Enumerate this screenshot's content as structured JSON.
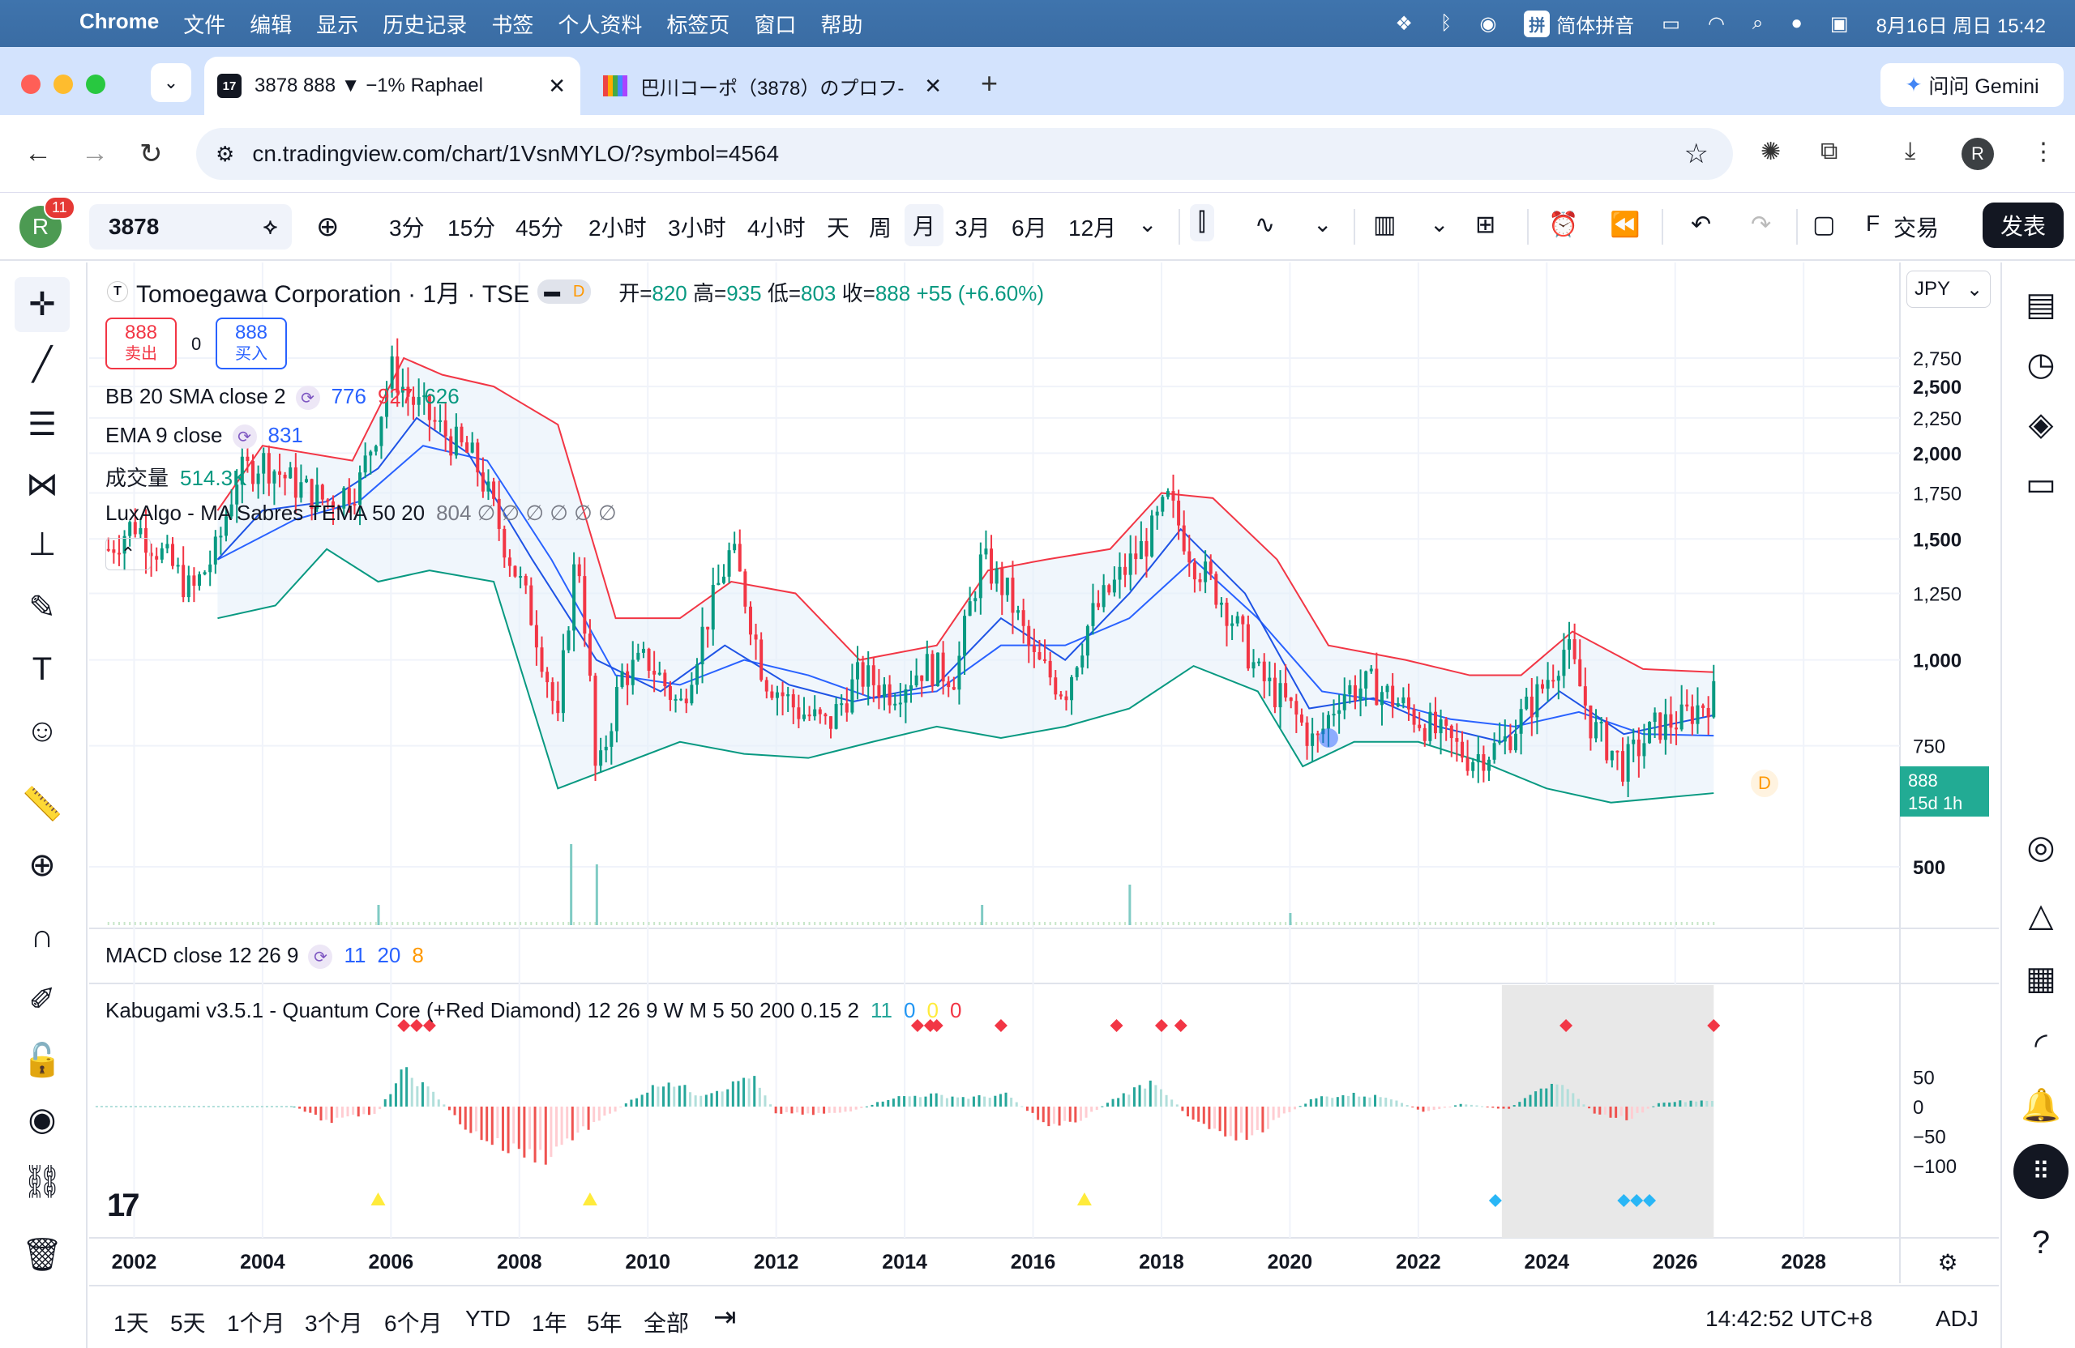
{
  "macos": {
    "app": "Chrome",
    "menus": [
      "文件",
      "编辑",
      "显示",
      "历史记录",
      "书签",
      "个人资料",
      "标签页",
      "窗口",
      "帮助"
    ],
    "ime": "拼",
    "ime_label": "简体拼音",
    "datetime": "8月16日 周日 15:42"
  },
  "chrome": {
    "tabs": [
      {
        "title": "3878 888 ▼ −1% Raphael",
        "favicon": "17"
      },
      {
        "title": "巴川コーポ（3878）のプロフ‐"
      }
    ],
    "gemini": "问问 Gemini",
    "url": "cn.tradingview.com/chart/1VsnMYLO/?symbol=4564",
    "avatar": "R"
  },
  "toolbar": {
    "avatar": "R",
    "notifications": "11",
    "symbol": "3878",
    "intervals": [
      "3分",
      "15分",
      "45分",
      "2小时",
      "3小时",
      "4小时",
      "天",
      "周",
      "月",
      "3月",
      "6月",
      "12月"
    ],
    "selected_interval": "月",
    "truncated": "F",
    "trade": "交易",
    "publish": "发表"
  },
  "chart": {
    "title": "Tomoegawa Corporation · 1月 · TSE",
    "t_badge": "T",
    "d_badge": "D",
    "ohlc": {
      "open_label": "开=",
      "open": "820",
      "high_label": "高=",
      "high": "935",
      "low_label": "低=",
      "low": "803",
      "close_label": "收=",
      "close": "888",
      "change": "+55 (+6.60%)"
    },
    "sell": {
      "price": "888",
      "label": "卖出"
    },
    "buy": {
      "price": "888",
      "label": "买入"
    },
    "spread": "0",
    "currency": "JPY",
    "price_label": {
      "price": "888",
      "countdown": "15d 1h"
    },
    "d_marker": "D",
    "indicators": [
      {
        "name": "BB 20 SMA close 2",
        "values": [
          "776",
          "927",
          "626"
        ],
        "colors": [
          "#2962ff",
          "#f23645",
          "#089981"
        ]
      },
      {
        "name": "EMA 9 close",
        "values": [
          "831"
        ],
        "colors": [
          "#2962ff"
        ]
      },
      {
        "name": "成交量",
        "values": [
          "514.3K"
        ],
        "colors": [
          "#089981"
        ]
      },
      {
        "name": "LuxAlgo - MA Sabres TEMA 50 20",
        "values": [
          "804 ∅ ∅ ∅ ∅ ∅ ∅"
        ],
        "colors": [
          "#787b86"
        ]
      }
    ],
    "macd": {
      "name": "MACD close 12 26 9",
      "values": [
        "11",
        "20",
        "8"
      ],
      "colors": [
        "#2962ff",
        "#2962ff",
        "#ff9800"
      ]
    },
    "kabugami": {
      "name": "Kabugami v3.5.1 - Quantum Core (+Red Diamond) 12 26 9 W M 5 50 200 0.15 2",
      "values": [
        "11",
        "0",
        "0",
        "0"
      ],
      "colors": [
        "#26a69a",
        "#2196f3",
        "#ffeb3b",
        "#f23645"
      ]
    },
    "price_axis": [
      "2,750",
      "2,500",
      "2,250",
      "2,000",
      "1,750",
      "1,500",
      "1,250",
      "1,000",
      "750",
      "500"
    ],
    "osc_axis": [
      "50",
      "0",
      "−50",
      "−100"
    ],
    "time_axis": [
      "2002",
      "2004",
      "2006",
      "2008",
      "2010",
      "2012",
      "2014",
      "2016",
      "2018",
      "2020",
      "2022",
      "2024",
      "2026",
      "2028"
    ]
  },
  "chart_data": {
    "type": "candlestick",
    "interval": "monthly",
    "symbol": "3878 TSE",
    "currency": "JPY",
    "ylim": [
      400,
      2900
    ],
    "x_range": [
      2001.3,
      2029.5
    ],
    "close_series": [
      {
        "x": 2001.6,
        "y": 1450
      },
      {
        "x": 2002.0,
        "y": 1580
      },
      {
        "x": 2002.5,
        "y": 1400
      },
      {
        "x": 2002.9,
        "y": 1250
      },
      {
        "x": 2003.3,
        "y": 1450
      },
      {
        "x": 2003.6,
        "y": 1850
      },
      {
        "x": 2004.0,
        "y": 1950
      },
      {
        "x": 2004.5,
        "y": 1800
      },
      {
        "x": 2005.0,
        "y": 1700
      },
      {
        "x": 2005.5,
        "y": 1800
      },
      {
        "x": 2005.8,
        "y": 2200
      },
      {
        "x": 2006.0,
        "y": 2650
      },
      {
        "x": 2006.3,
        "y": 2400
      },
      {
        "x": 2006.8,
        "y": 2150
      },
      {
        "x": 2007.3,
        "y": 1950
      },
      {
        "x": 2007.8,
        "y": 1450
      },
      {
        "x": 2008.2,
        "y": 1150
      },
      {
        "x": 2008.6,
        "y": 800
      },
      {
        "x": 2008.9,
        "y": 1450
      },
      {
        "x": 2009.2,
        "y": 650
      },
      {
        "x": 2009.6,
        "y": 950
      },
      {
        "x": 2010.0,
        "y": 1000
      },
      {
        "x": 2010.5,
        "y": 850
      },
      {
        "x": 2011.0,
        "y": 1200
      },
      {
        "x": 2011.3,
        "y": 1450
      },
      {
        "x": 2011.8,
        "y": 950
      },
      {
        "x": 2012.3,
        "y": 850
      },
      {
        "x": 2012.8,
        "y": 800
      },
      {
        "x": 2013.3,
        "y": 950
      },
      {
        "x": 2013.8,
        "y": 900
      },
      {
        "x": 2014.3,
        "y": 980
      },
      {
        "x": 2014.8,
        "y": 950
      },
      {
        "x": 2015.2,
        "y": 1400
      },
      {
        "x": 2015.6,
        "y": 1250
      },
      {
        "x": 2016.0,
        "y": 1000
      },
      {
        "x": 2016.5,
        "y": 900
      },
      {
        "x": 2016.9,
        "y": 1150
      },
      {
        "x": 2017.3,
        "y": 1300
      },
      {
        "x": 2017.8,
        "y": 1500
      },
      {
        "x": 2018.1,
        "y": 1700
      },
      {
        "x": 2018.5,
        "y": 1400
      },
      {
        "x": 2019.0,
        "y": 1200
      },
      {
        "x": 2019.5,
        "y": 950
      },
      {
        "x": 2020.0,
        "y": 850
      },
      {
        "x": 2020.4,
        "y": 750
      },
      {
        "x": 2020.8,
        "y": 900
      },
      {
        "x": 2021.3,
        "y": 920
      },
      {
        "x": 2021.8,
        "y": 850
      },
      {
        "x": 2022.3,
        "y": 780
      },
      {
        "x": 2022.8,
        "y": 720
      },
      {
        "x": 2023.3,
        "y": 750
      },
      {
        "x": 2023.9,
        "y": 900
      },
      {
        "x": 2024.3,
        "y": 1050
      },
      {
        "x": 2024.7,
        "y": 800
      },
      {
        "x": 2025.2,
        "y": 700
      },
      {
        "x": 2025.7,
        "y": 800
      },
      {
        "x": 2026.1,
        "y": 820
      },
      {
        "x": 2026.6,
        "y": 888
      }
    ],
    "bb_upper": [
      {
        "x": 2003.3,
        "y": 1650
      },
      {
        "x": 2004.0,
        "y": 2050
      },
      {
        "x": 2004.7,
        "y": 2000
      },
      {
        "x": 2005.4,
        "y": 1950
      },
      {
        "x": 2006.2,
        "y": 2750
      },
      {
        "x": 2006.8,
        "y": 2600
      },
      {
        "x": 2007.6,
        "y": 2500
      },
      {
        "x": 2008.6,
        "y": 2200
      },
      {
        "x": 2009.5,
        "y": 1150
      },
      {
        "x": 2010.5,
        "y": 1150
      },
      {
        "x": 2011.3,
        "y": 1300
      },
      {
        "x": 2012.3,
        "y": 1250
      },
      {
        "x": 2013.3,
        "y": 1000
      },
      {
        "x": 2014.5,
        "y": 1050
      },
      {
        "x": 2015.3,
        "y": 1350
      },
      {
        "x": 2016.2,
        "y": 1400
      },
      {
        "x": 2017.2,
        "y": 1450
      },
      {
        "x": 2018.0,
        "y": 1750
      },
      {
        "x": 2018.8,
        "y": 1720
      },
      {
        "x": 2019.8,
        "y": 1400
      },
      {
        "x": 2020.6,
        "y": 1050
      },
      {
        "x": 2021.8,
        "y": 1000
      },
      {
        "x": 2022.8,
        "y": 950
      },
      {
        "x": 2023.6,
        "y": 950
      },
      {
        "x": 2024.4,
        "y": 1100
      },
      {
        "x": 2025.5,
        "y": 970
      },
      {
        "x": 2026.6,
        "y": 960
      }
    ],
    "bb_lower": [
      {
        "x": 2003.3,
        "y": 1150
      },
      {
        "x": 2004.2,
        "y": 1200
      },
      {
        "x": 2005.0,
        "y": 1450
      },
      {
        "x": 2005.8,
        "y": 1300
      },
      {
        "x": 2006.6,
        "y": 1350
      },
      {
        "x": 2007.6,
        "y": 1300
      },
      {
        "x": 2008.6,
        "y": 650
      },
      {
        "x": 2009.5,
        "y": 700
      },
      {
        "x": 2010.5,
        "y": 760
      },
      {
        "x": 2011.5,
        "y": 730
      },
      {
        "x": 2012.5,
        "y": 720
      },
      {
        "x": 2013.5,
        "y": 760
      },
      {
        "x": 2014.5,
        "y": 800
      },
      {
        "x": 2015.5,
        "y": 770
      },
      {
        "x": 2016.5,
        "y": 800
      },
      {
        "x": 2017.5,
        "y": 850
      },
      {
        "x": 2018.5,
        "y": 980
      },
      {
        "x": 2019.5,
        "y": 900
      },
      {
        "x": 2020.2,
        "y": 700
      },
      {
        "x": 2021.0,
        "y": 760
      },
      {
        "x": 2022.0,
        "y": 760
      },
      {
        "x": 2023.0,
        "y": 710
      },
      {
        "x": 2024.0,
        "y": 650
      },
      {
        "x": 2025.0,
        "y": 620
      },
      {
        "x": 2026.6,
        "y": 640
      }
    ],
    "ema9": [
      {
        "x": 2003.3,
        "y": 1400
      },
      {
        "x": 2004.0,
        "y": 1650
      },
      {
        "x": 2005.0,
        "y": 1700
      },
      {
        "x": 2005.8,
        "y": 1900
      },
      {
        "x": 2006.4,
        "y": 2250
      },
      {
        "x": 2007.2,
        "y": 2000
      },
      {
        "x": 2008.2,
        "y": 1400
      },
      {
        "x": 2009.2,
        "y": 1000
      },
      {
        "x": 2010.2,
        "y": 900
      },
      {
        "x": 2011.2,
        "y": 1050
      },
      {
        "x": 2012.2,
        "y": 920
      },
      {
        "x": 2013.2,
        "y": 870
      },
      {
        "x": 2014.5,
        "y": 920
      },
      {
        "x": 2015.5,
        "y": 1150
      },
      {
        "x": 2016.5,
        "y": 1000
      },
      {
        "x": 2017.5,
        "y": 1250
      },
      {
        "x": 2018.3,
        "y": 1550
      },
      {
        "x": 2019.3,
        "y": 1250
      },
      {
        "x": 2020.3,
        "y": 850
      },
      {
        "x": 2021.3,
        "y": 880
      },
      {
        "x": 2022.3,
        "y": 800
      },
      {
        "x": 2023.3,
        "y": 760
      },
      {
        "x": 2024.2,
        "y": 900
      },
      {
        "x": 2025.2,
        "y": 780
      },
      {
        "x": 2026.6,
        "y": 831
      }
    ],
    "bb_basis": [
      {
        "x": 2003.3,
        "y": 1400
      },
      {
        "x": 2004.5,
        "y": 1600
      },
      {
        "x": 2005.5,
        "y": 1700
      },
      {
        "x": 2006.5,
        "y": 2050
      },
      {
        "x": 2007.5,
        "y": 1950
      },
      {
        "x": 2008.5,
        "y": 1400
      },
      {
        "x": 2009.5,
        "y": 950
      },
      {
        "x": 2010.5,
        "y": 920
      },
      {
        "x": 2011.5,
        "y": 1000
      },
      {
        "x": 2012.5,
        "y": 950
      },
      {
        "x": 2013.5,
        "y": 880
      },
      {
        "x": 2014.5,
        "y": 900
      },
      {
        "x": 2015.5,
        "y": 1050
      },
      {
        "x": 2016.5,
        "y": 1050
      },
      {
        "x": 2017.5,
        "y": 1150
      },
      {
        "x": 2018.5,
        "y": 1400
      },
      {
        "x": 2019.5,
        "y": 1150
      },
      {
        "x": 2020.5,
        "y": 900
      },
      {
        "x": 2021.5,
        "y": 870
      },
      {
        "x": 2022.5,
        "y": 820
      },
      {
        "x": 2023.5,
        "y": 800
      },
      {
        "x": 2024.5,
        "y": 840
      },
      {
        "x": 2025.5,
        "y": 780
      },
      {
        "x": 2026.6,
        "y": 776
      }
    ],
    "oscillator": [
      {
        "x": 2001.3,
        "y": 0
      },
      {
        "x": 2004.5,
        "y": 0
      },
      {
        "x": 2005.0,
        "y": -25
      },
      {
        "x": 2005.8,
        "y": -10
      },
      {
        "x": 2006.2,
        "y": 60
      },
      {
        "x": 2006.7,
        "y": 20
      },
      {
        "x": 2007.2,
        "y": -40
      },
      {
        "x": 2007.8,
        "y": -70
      },
      {
        "x": 2008.4,
        "y": -85
      },
      {
        "x": 2008.9,
        "y": -45
      },
      {
        "x": 2009.4,
        "y": -15
      },
      {
        "x": 2009.8,
        "y": 15
      },
      {
        "x": 2010.3,
        "y": 45
      },
      {
        "x": 2010.8,
        "y": 20
      },
      {
        "x": 2011.3,
        "y": 35
      },
      {
        "x": 2011.6,
        "y": 55
      },
      {
        "x": 2012.0,
        "y": -10
      },
      {
        "x": 2012.6,
        "y": -12
      },
      {
        "x": 2013.2,
        "y": -8
      },
      {
        "x": 2013.8,
        "y": 15
      },
      {
        "x": 2014.4,
        "y": 20
      },
      {
        "x": 2015.0,
        "y": 15
      },
      {
        "x": 2015.6,
        "y": 20
      },
      {
        "x": 2016.2,
        "y": -30
      },
      {
        "x": 2016.7,
        "y": -25
      },
      {
        "x": 2017.3,
        "y": 15
      },
      {
        "x": 2017.9,
        "y": 45
      },
      {
        "x": 2018.4,
        "y": -15
      },
      {
        "x": 2018.9,
        "y": -40
      },
      {
        "x": 2019.4,
        "y": -55
      },
      {
        "x": 2019.9,
        "y": -15
      },
      {
        "x": 2020.4,
        "y": 15
      },
      {
        "x": 2021.0,
        "y": 20
      },
      {
        "x": 2021.6,
        "y": 15
      },
      {
        "x": 2022.1,
        "y": -10
      },
      {
        "x": 2022.7,
        "y": 5
      },
      {
        "x": 2023.4,
        "y": -5
      },
      {
        "x": 2023.9,
        "y": 35
      },
      {
        "x": 2024.3,
        "y": 30
      },
      {
        "x": 2024.8,
        "y": -15
      },
      {
        "x": 2025.3,
        "y": -20
      },
      {
        "x": 2025.8,
        "y": 8
      },
      {
        "x": 2026.6,
        "y": 11
      }
    ],
    "red_diamonds": [
      2006.2,
      2006.4,
      2006.6,
      2014.2,
      2014.4,
      2014.5,
      2015.5,
      2017.3,
      2018.0,
      2018.3,
      2024.3,
      2026.6
    ],
    "blue_diamonds": [
      2023.2,
      2025.2,
      2025.4,
      2025.6
    ],
    "yellow_triangles": [
      2005.8,
      2009.1,
      2016.8
    ],
    "shaded_x_range": [
      2023.3,
      2026.6
    ],
    "volume_spikes": [
      {
        "x": 2005.8,
        "y": 25
      },
      {
        "x": 2008.8,
        "y": 100
      },
      {
        "x": 2009.2,
        "y": 75
      },
      {
        "x": 2015.2,
        "y": 25
      },
      {
        "x": 2017.5,
        "y": 50
      },
      {
        "x": 2020.0,
        "y": 15
      }
    ]
  },
  "left_tools": [
    {
      "name": "crosshair-tool-icon",
      "glyph": "✛"
    },
    {
      "name": "trendline-tool-icon",
      "glyph": "╱"
    },
    {
      "name": "fib-tool-icon",
      "glyph": "☰"
    },
    {
      "name": "pattern-tool-icon",
      "glyph": "⋈"
    },
    {
      "name": "prediction-tool-icon",
      "glyph": "⊥"
    },
    {
      "name": "brush-tool-icon",
      "glyph": "✎"
    },
    {
      "name": "text-tool-icon",
      "glyph": "T"
    },
    {
      "name": "emoji-tool-icon",
      "glyph": "☺"
    },
    {
      "name": "ruler-tool-icon",
      "glyph": "📏"
    },
    {
      "name": "zoom-tool-icon",
      "glyph": "⊕"
    },
    {
      "name": "magnet-tool-icon",
      "glyph": "∩"
    },
    {
      "name": "lock-drawing-icon",
      "glyph": "✐"
    },
    {
      "name": "lock-icon",
      "glyph": "🔓"
    },
    {
      "name": "eye-icon",
      "glyph": "◉"
    },
    {
      "name": "link-icon",
      "glyph": "⛓"
    },
    {
      "name": "trash-icon",
      "glyph": "🗑"
    }
  ],
  "right_tools": [
    {
      "name": "watchlist-icon",
      "glyph": "▤"
    },
    {
      "name": "alert-clock-icon",
      "glyph": "◷"
    },
    {
      "name": "layers-icon",
      "glyph": "◈"
    },
    {
      "name": "chat-icon",
      "glyph": "▭"
    },
    {
      "name": "target-icon",
      "glyph": "◎"
    },
    {
      "name": "ideas-icon",
      "glyph": "△"
    },
    {
      "name": "calendar-icon",
      "glyph": "▦"
    },
    {
      "name": "stream-icon",
      "glyph": "◜"
    },
    {
      "name": "bell-icon",
      "glyph": "🔔"
    },
    {
      "name": "apps-grid-icon",
      "glyph": "⠿"
    },
    {
      "name": "help-icon",
      "glyph": "?"
    }
  ],
  "range_bar": {
    "ranges": [
      "1天",
      "5天",
      "1个月",
      "3个月",
      "6个月",
      "YTD",
      "1年",
      "5年",
      "全部"
    ],
    "time": "14:42:52 UTC+8",
    "adj": "ADJ"
  }
}
